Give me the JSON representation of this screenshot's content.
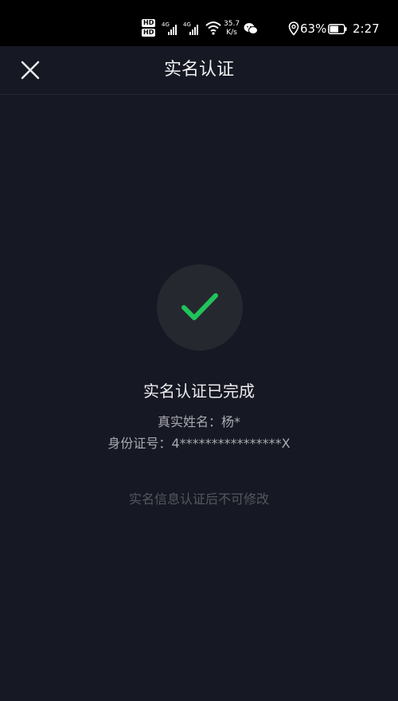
{
  "status_bar": {
    "hd1": "HD",
    "hd2": "HD",
    "sig1_label": "4G",
    "sig2_label": "4G",
    "speed_value": "35.7",
    "speed_unit": "K/s",
    "battery_pct": "63%",
    "time": "2:27"
  },
  "nav": {
    "title": "实名认证",
    "close_icon": "close-icon"
  },
  "result": {
    "icon": "check-icon",
    "title": "实名认证已完成",
    "name_label": "真实姓名：",
    "name_value": "杨*",
    "id_label": "身份证号：",
    "id_value": "4****************X",
    "notice": "实名信息认证后不可修改"
  },
  "colors": {
    "background": "#161823",
    "accent_check": "#20c45a",
    "circle": "#262830"
  }
}
